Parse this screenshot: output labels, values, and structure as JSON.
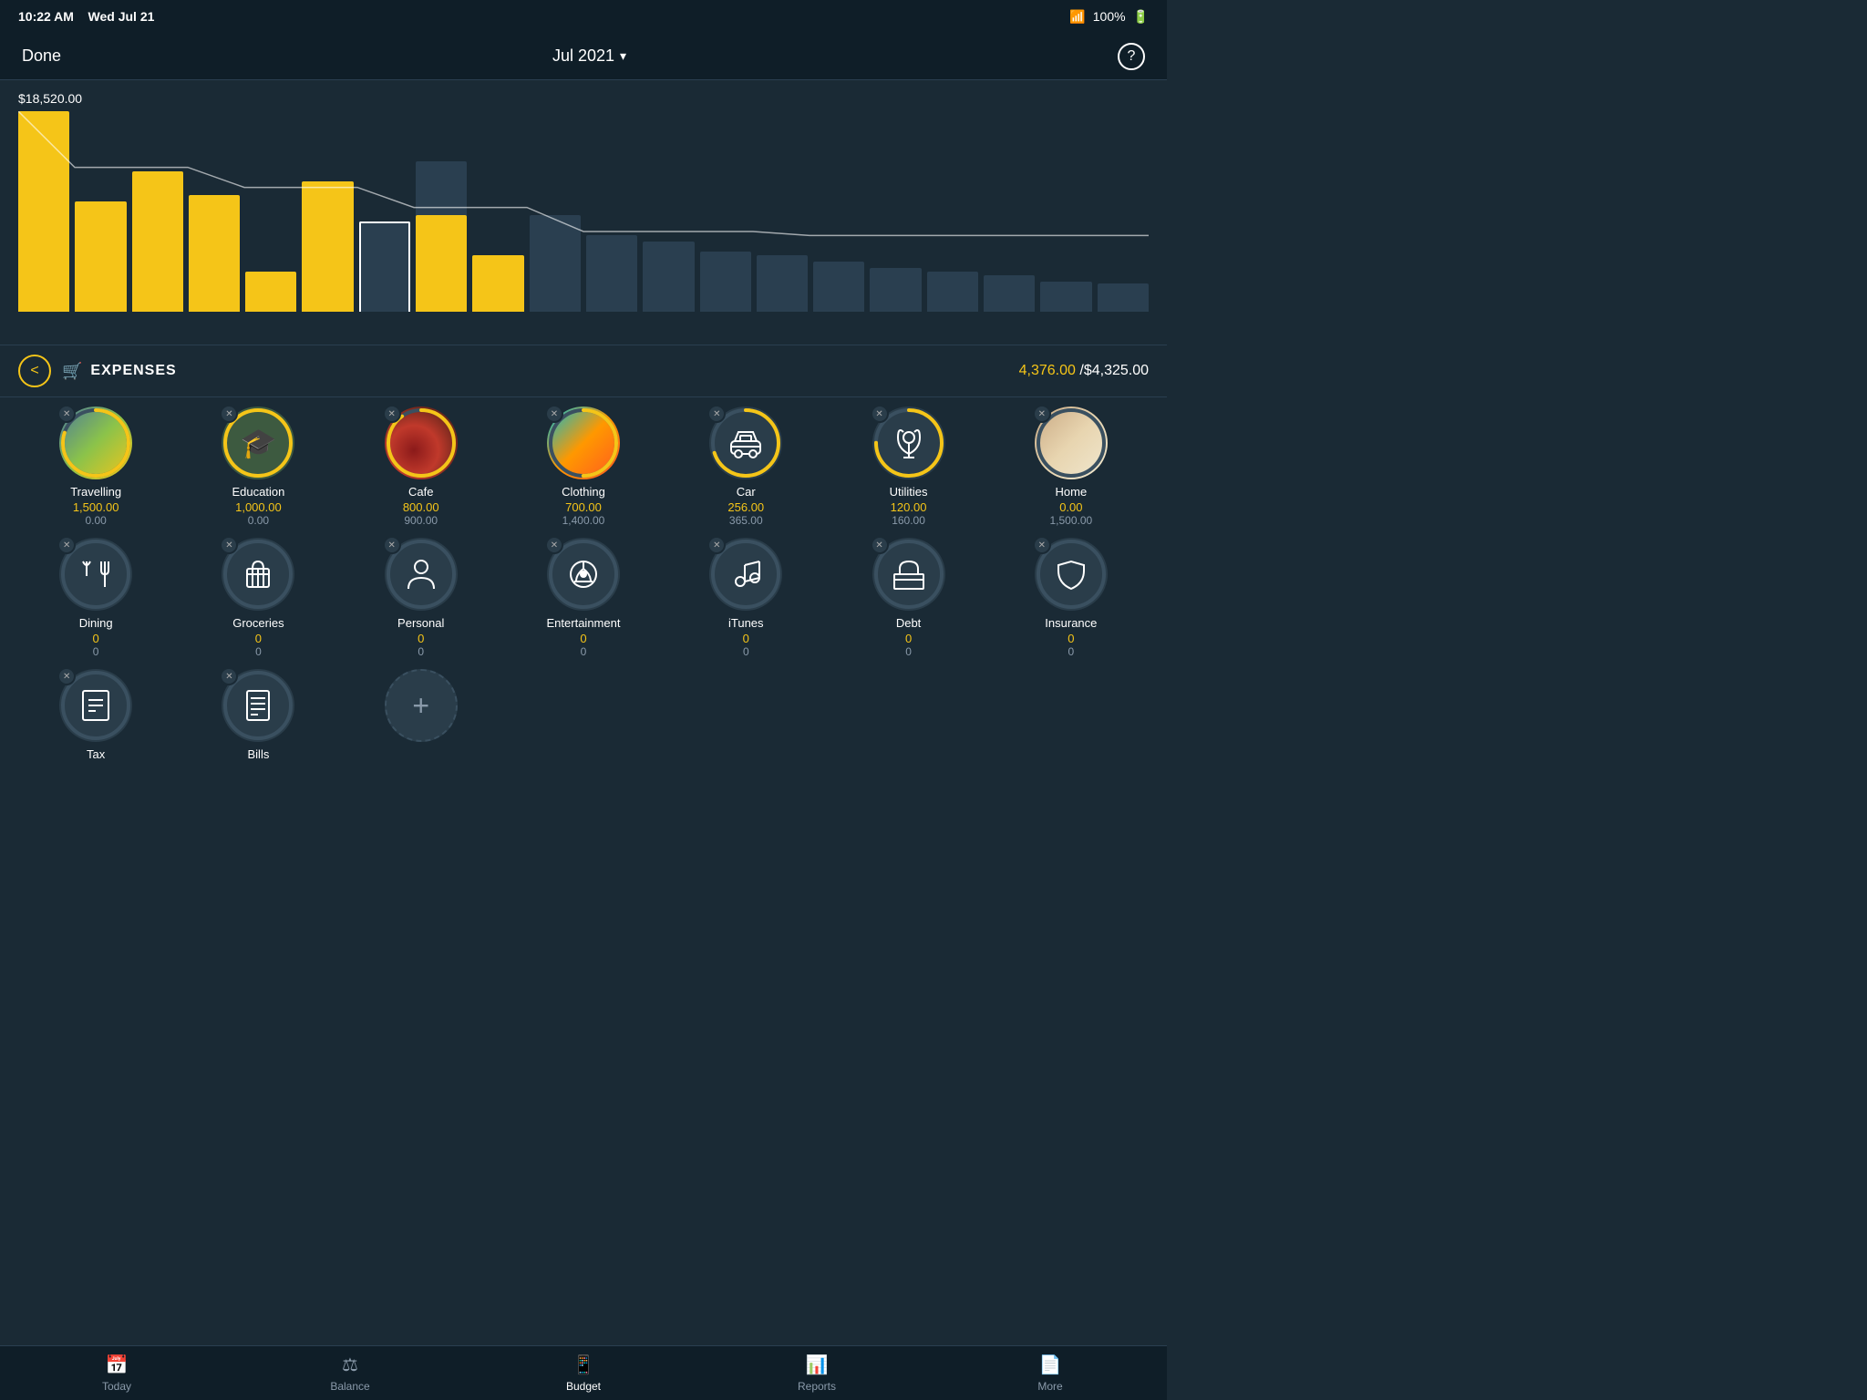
{
  "statusBar": {
    "time": "10:22 AM",
    "date": "Wed Jul 21",
    "wifi": "WiFi",
    "battery": "100%"
  },
  "header": {
    "doneLabel": "Done",
    "monthLabel": "Jul 2021",
    "helpLabel": "?"
  },
  "chart": {
    "maxLabel": "$18,520.00",
    "bars": [
      100,
      55,
      70,
      58,
      20,
      65,
      45,
      75,
      28,
      48,
      38,
      35,
      30,
      28,
      25,
      22,
      20,
      18,
      15,
      14
    ],
    "fills": [
      100,
      55,
      70,
      58,
      20,
      65,
      0,
      48,
      28,
      0,
      0,
      0,
      0,
      0,
      0,
      0,
      0,
      0,
      0,
      0
    ]
  },
  "expensesRow": {
    "backLabel": "<",
    "label": "EXPENSES",
    "spent": "4,376.00",
    "budget": "/$4,325.00"
  },
  "categories": [
    {
      "name": "Travelling",
      "spent": "1,500.00",
      "budget": "0.00",
      "type": "image",
      "imageClass": "img-travelling",
      "ringColor": "#f5c518",
      "ringPercent": 80
    },
    {
      "name": "Education",
      "spent": "1,000.00",
      "budget": "0.00",
      "type": "icon",
      "iconUnicode": "🎓",
      "ringColor": "#f5c518",
      "ringPercent": 100,
      "bgColor": "#3d5a40"
    },
    {
      "name": "Cafe",
      "spent": "800.00",
      "budget": "900.00",
      "type": "image",
      "imageClass": "img-cafe",
      "ringColor": "#f5c518",
      "ringPercent": 90
    },
    {
      "name": "Clothing",
      "spent": "700.00",
      "budget": "1,400.00",
      "type": "image",
      "imageClass": "img-clothing",
      "ringColor": "#f5c518",
      "ringPercent": 50
    },
    {
      "name": "Car",
      "spent": "256.00",
      "budget": "365.00",
      "type": "icon",
      "iconUnicode": "🚗",
      "ringColor": "#f5c518",
      "ringPercent": 70
    },
    {
      "name": "Utilities",
      "spent": "120.00",
      "budget": "160.00",
      "type": "icon",
      "iconUnicode": "🔧",
      "ringColor": "#f5c518",
      "ringPercent": 75,
      "bgColor": "#2a3d4a"
    },
    {
      "name": "Home",
      "spent": "0.00",
      "budget": "1,500.00",
      "type": "image",
      "imageClass": "img-home",
      "ringColor": "#f5c518",
      "ringPercent": 0
    },
    {
      "name": "Dining",
      "spent": "0",
      "budget": "0",
      "type": "icon",
      "iconUnicode": "🍴",
      "ringColor": "#3a5060",
      "ringPercent": 0
    },
    {
      "name": "Groceries",
      "spent": "0",
      "budget": "0",
      "type": "icon",
      "iconUnicode": "🛒",
      "ringColor": "#3a5060",
      "ringPercent": 0
    },
    {
      "name": "Personal",
      "spent": "0",
      "budget": "0",
      "type": "icon",
      "iconUnicode": "👤",
      "ringColor": "#3a5060",
      "ringPercent": 0
    },
    {
      "name": "Entertainment",
      "spent": "0",
      "budget": "0",
      "type": "icon",
      "iconUnicode": "🎡",
      "ringColor": "#3a5060",
      "ringPercent": 0
    },
    {
      "name": "iTunes",
      "spent": "0",
      "budget": "0",
      "type": "icon",
      "iconUnicode": "♪",
      "ringColor": "#3a5060",
      "ringPercent": 0
    },
    {
      "name": "Debt",
      "spent": "0",
      "budget": "0",
      "type": "icon",
      "iconUnicode": "🏛",
      "ringColor": "#3a5060",
      "ringPercent": 0
    },
    {
      "name": "Insurance",
      "spent": "0",
      "budget": "0",
      "type": "icon",
      "iconUnicode": "☂",
      "ringColor": "#3a5060",
      "ringPercent": 0
    },
    {
      "name": "Tax",
      "spent": "",
      "budget": "",
      "type": "icon",
      "iconUnicode": "🏛",
      "ringColor": "#3a5060",
      "ringPercent": 0
    },
    {
      "name": "Bills",
      "spent": "",
      "budget": "",
      "type": "icon",
      "iconUnicode": "📋",
      "ringColor": "#3a5060",
      "ringPercent": 0
    }
  ],
  "tabs": [
    {
      "label": "Today",
      "icon": "📅",
      "active": false
    },
    {
      "label": "Balance",
      "icon": "⚖",
      "active": false
    },
    {
      "label": "Budget",
      "icon": "📱",
      "active": true
    },
    {
      "label": "Reports",
      "icon": "📊",
      "active": false
    },
    {
      "label": "More",
      "icon": "📄",
      "active": false
    }
  ]
}
